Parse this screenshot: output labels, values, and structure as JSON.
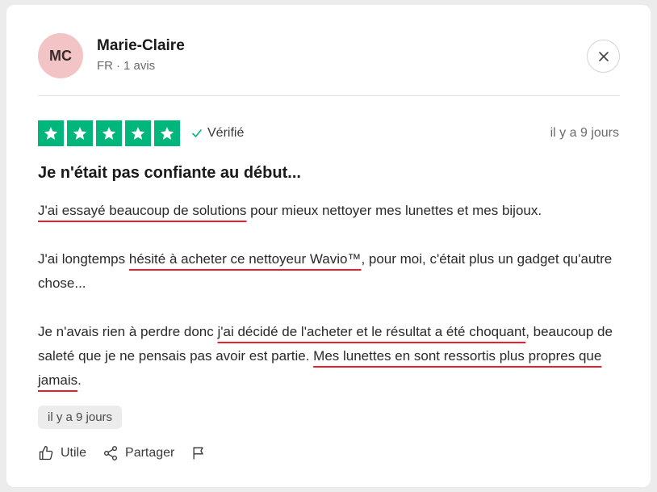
{
  "reviewer": {
    "initials": "MC",
    "name": "Marie-Claire",
    "country": "FR",
    "separator": "·",
    "review_count": "1 avis",
    "avatar_color": "#f2c4c6"
  },
  "close_icon": "close-icon",
  "rating": {
    "stars": 5,
    "max": 5,
    "color": "#00b67a"
  },
  "verified_label": "Vérifié",
  "date_posted": "il y a 9 jours",
  "review": {
    "title": "Je n'était pas confiante au début...",
    "p1": {
      "u1": "J'ai essayé beaucoup de solutions",
      "t1": " pour mieux nettoyer mes lunettes et mes bijoux."
    },
    "p2": {
      "t1": "J'ai longtemps ",
      "u1": "hésité à acheter ce nettoyeur Wavio™",
      "t2": ", pour moi, c'était plus un gadget qu'autre chose..."
    },
    "p3": {
      "t1": "Je n'avais rien à perdre donc ",
      "u1": "j'ai décidé de l'acheter et le résultat a été choquant",
      "t2": ", beaucoup de saleté que je ne pensais pas avoir est partie. ",
      "u2": "Mes lunettes en sont ressortis plus propres que jamais",
      "t3": "."
    },
    "highlight_color": "#e8202a"
  },
  "experience_date": "il y a 9 jours",
  "actions": {
    "useful_label": "Utile",
    "share_label": "Partager"
  }
}
